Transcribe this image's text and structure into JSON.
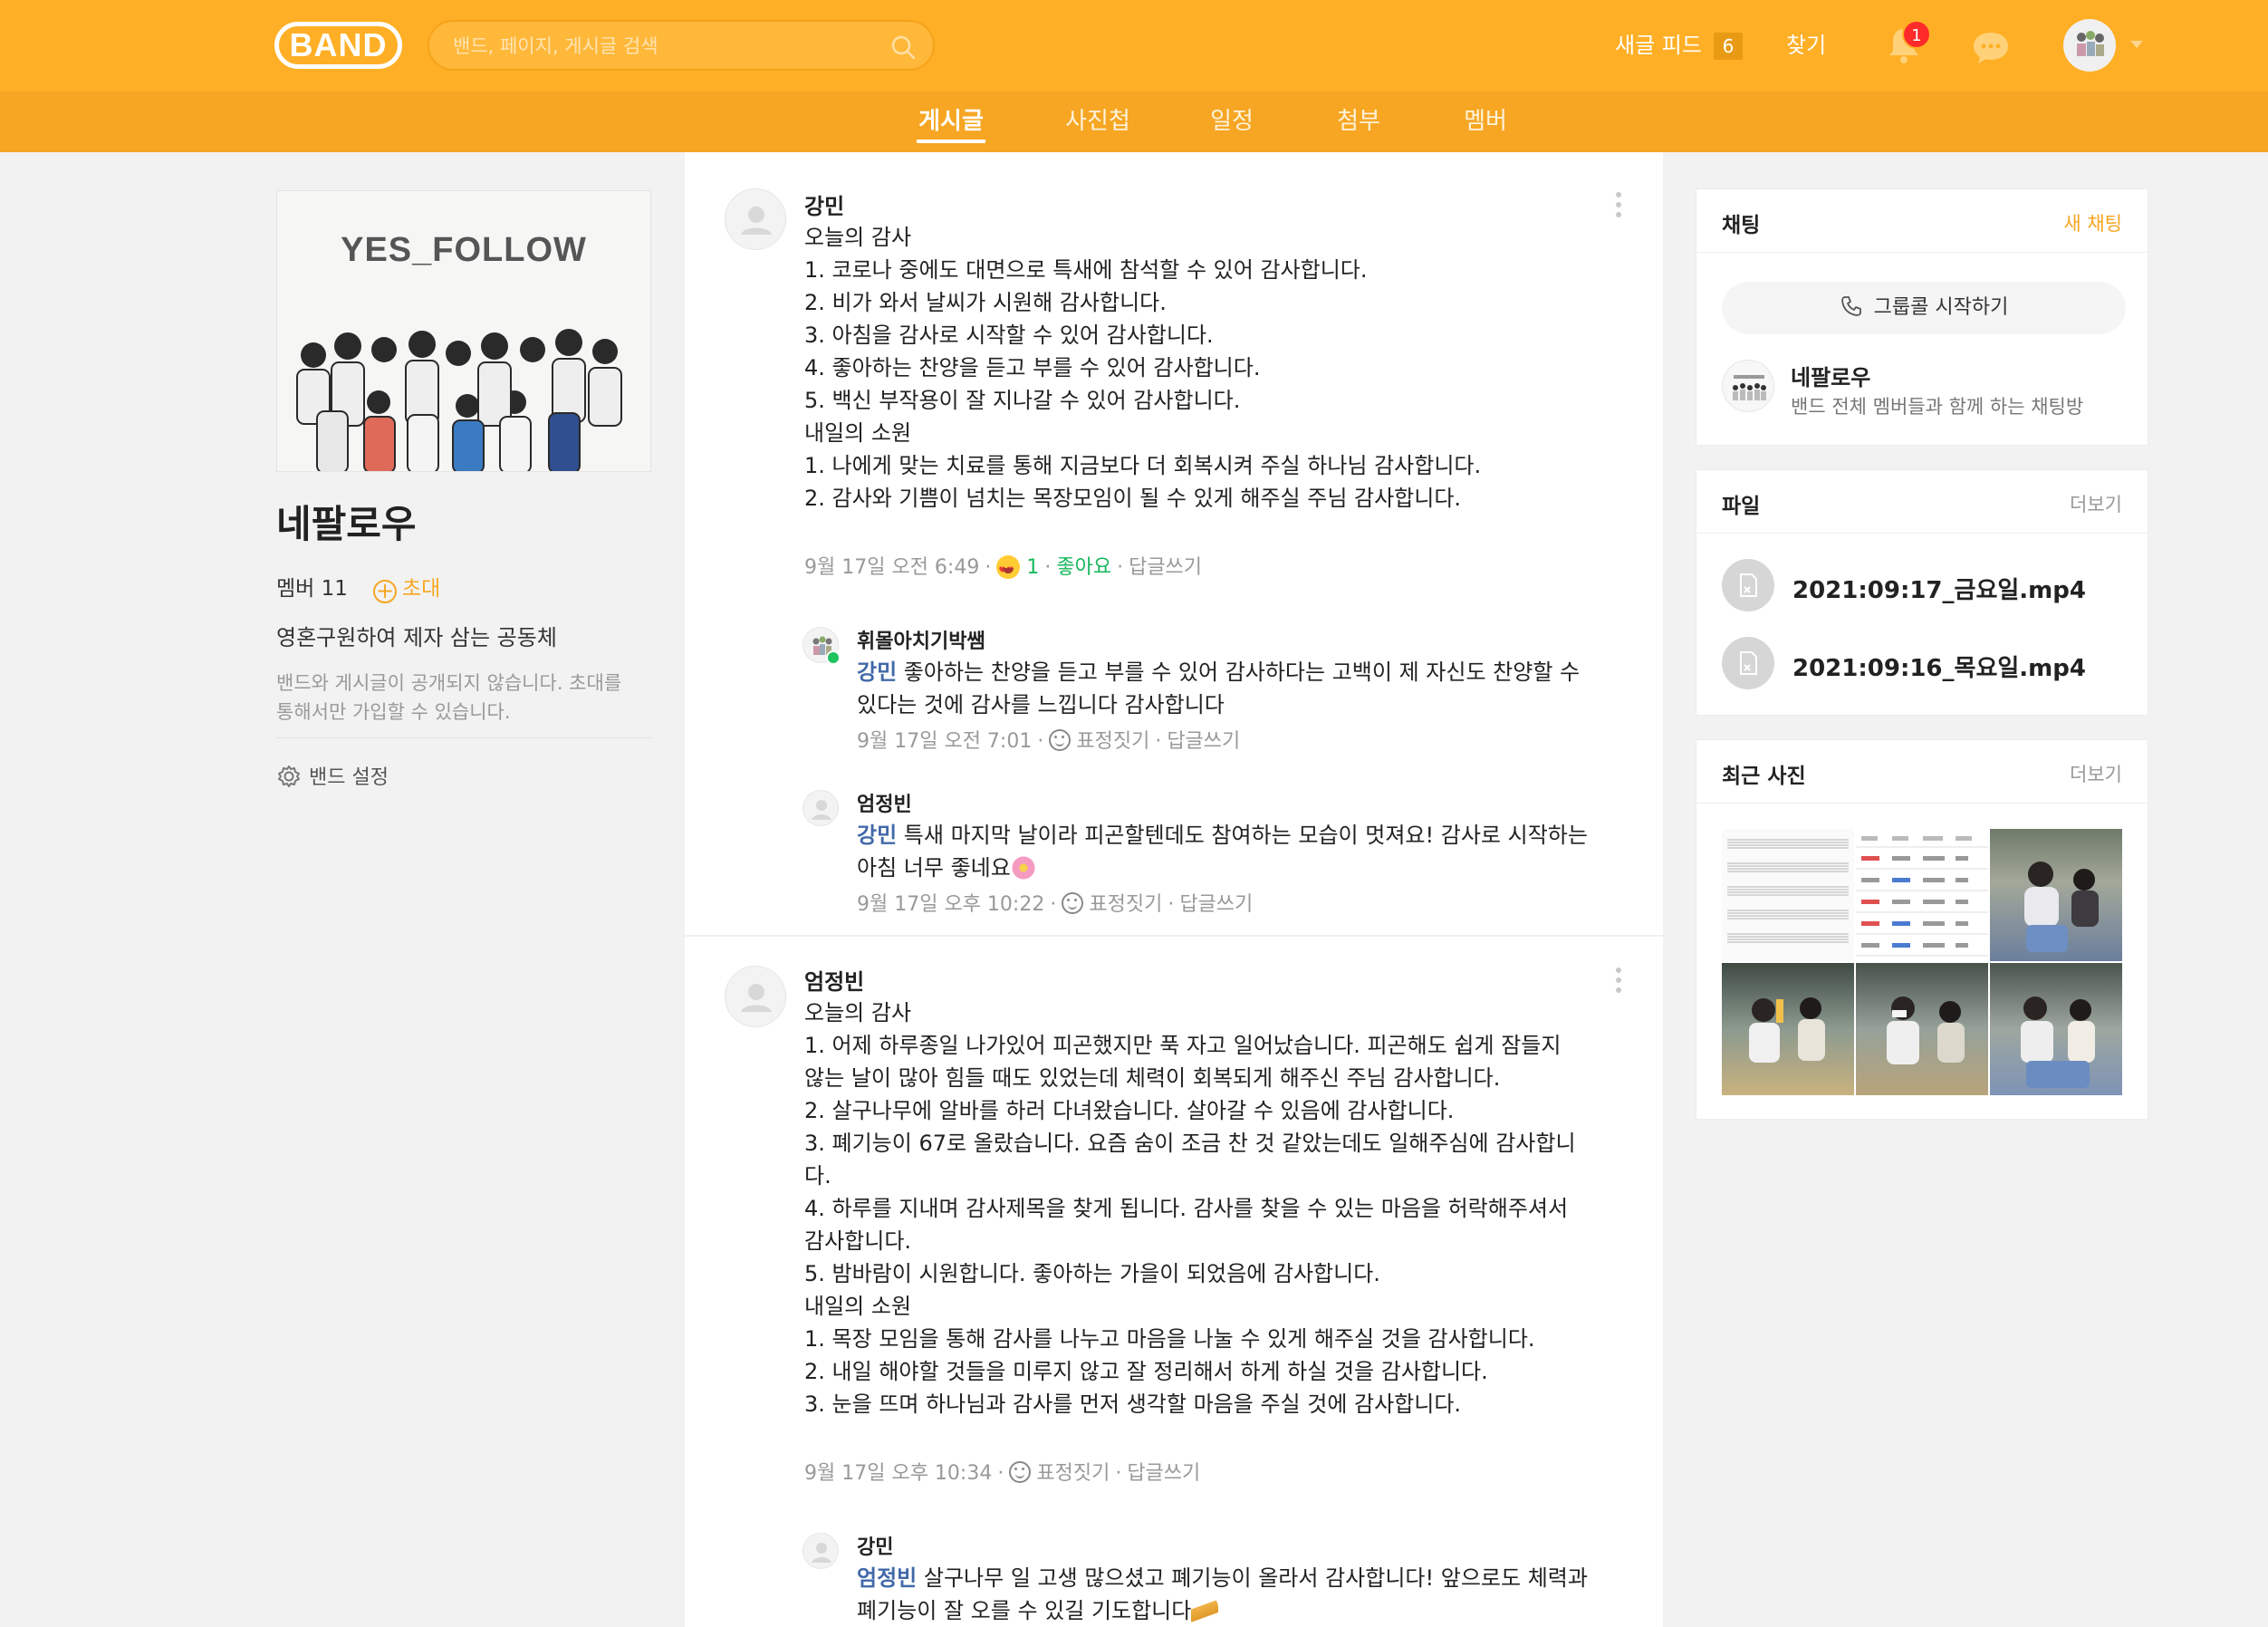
{
  "header": {
    "logo_text": "BAND",
    "search_placeholder": "밴드, 페이지, 게시글 검색",
    "feed_label": "새글 피드",
    "feed_count": "6",
    "find_label": "찾기",
    "notification_count": "1",
    "brand_color": "#ffaf25"
  },
  "tabs": [
    {
      "label": "게시글",
      "active": true
    },
    {
      "label": "사진첩",
      "active": false
    },
    {
      "label": "일정",
      "active": false
    },
    {
      "label": "첨부",
      "active": false
    },
    {
      "label": "멤버",
      "active": false
    }
  ],
  "band": {
    "cover_title": "YES_FOLLOW",
    "name": "네팔로우",
    "member_count": "멤버 11",
    "invite_label": "초대",
    "description": "영혼구원하여 제자 삼는 공동체",
    "privacy_note_line1": "밴드와 게시글이 공개되지 않습니다. 초대를",
    "privacy_note_line2": "통해서만 가입할 수 있습니다.",
    "settings_label": "밴드 설정"
  },
  "posts": [
    {
      "author": "강민",
      "lines": [
        "오늘의 감사",
        "1. 코로나 중에도 대면으로 특새에 참석할 수 있어 감사합니다.",
        "2. 비가 와서 날씨가 시원해 감사합니다.",
        "3. 아침을 감사로 시작할 수 있어 감사합니다.",
        "4. 좋아하는 찬양을 듣고 부를 수 있어 감사합니다.",
        "5. 백신 부작용이 잘 지나갈 수 있어 감사합니다.",
        "",
        "내일의 소원",
        "1. 나에게 맞는 치료를 통해 지금보다 더 회복시켜 주실 하나님 감사합니다.",
        "2. 감사와 기쁨이 넘치는 목장모임이 될 수 있게 해주실 주님 감사합니다."
      ],
      "time": "9월 17일 오전 6:49",
      "like_count": "1",
      "like_label": "좋아요",
      "reply_label": "답글쓰기",
      "comments": [
        {
          "author": "휘몰아치기박쌤",
          "mention": "강민",
          "line1": " 좋아하는 찬양을 듣고 부를 수 있어 감사하다는 고백이 제 자신도 찬양할 수",
          "line2": "있다는 것에 감사를 느낍니다 감사합니다",
          "time": "9월 17일 오전 7:01",
          "react_label": "표정짓기",
          "reply_label": "답글쓰기"
        },
        {
          "author": "엄정빈",
          "mention": "강민",
          "line1": " 특새 마지막 날이라 피곤할텐데도 참여하는 모습이 멋져요! 감사로 시작하는",
          "line2": "아침 너무 좋네요",
          "time": "9월 17일 오후 10:22",
          "react_label": "표정짓기",
          "reply_label": "답글쓰기"
        }
      ]
    },
    {
      "author": "엄정빈",
      "lines": [
        "오늘의 감사",
        "1. 어제 하루종일 나가있어 피곤했지만 푹 자고 일어났습니다. 피곤해도 쉽게 잠들지",
        "않는 날이 많아 힘들 때도 있었는데 체력이 회복되게 해주신 주님 감사합니다.",
        "2. 살구나무에 알바를 하러 다녀왔습니다. 살아갈 수 있음에 감사합니다.",
        "3. 폐기능이 67로 올랐습니다. 요즘 숨이 조금 찬 것 같았는데도 일해주심에 감사합니",
        "다.",
        "4. 하루를 지내며 감사제목을 찾게 됩니다. 감사를 찾을 수 있는 마음을 허락해주셔서",
        "감사합니다.",
        "5. 밤바람이 시원합니다. 좋아하는 가을이 되었음에 감사합니다.",
        "",
        "내일의 소원",
        "1. 목장 모임을 통해 감사를 나누고 마음을 나눌 수 있게 해주실 것을 감사합니다.",
        "2. 내일 해야할 것들을 미루지 않고 잘 정리해서 하게 하실 것을 감사합니다.",
        "3. 눈을 뜨며 하나님과 감사를 먼저 생각할 마음을 주실 것에 감사합니다."
      ],
      "time": "9월 17일 오후 10:34",
      "react_label": "표정짓기",
      "reply_label": "답글쓰기",
      "comments": [
        {
          "author": "강민",
          "mention": "엄정빈",
          "line1": " 살구나무 일 고생 많으셨고 폐기능이 올라서 감사합니다! 앞으로도 체력과",
          "line2": "폐기능이 잘 오를 수 있길 기도합니다"
        }
      ]
    }
  ],
  "chat_panel": {
    "title": "채팅",
    "new_chat_label": "새 채팅",
    "group_call_label": "그룹콜 시작하기",
    "room_name": "네팔로우",
    "room_desc": "밴드 전체 멤버들과 함께 하는 채팅방"
  },
  "file_panel": {
    "title": "파일",
    "more_label": "더보기",
    "files": [
      "2021:09:17_금요일.mp4",
      "2021:09:16_목요일.mp4"
    ]
  },
  "photo_panel": {
    "title": "최근 사진",
    "more_label": "더보기"
  }
}
